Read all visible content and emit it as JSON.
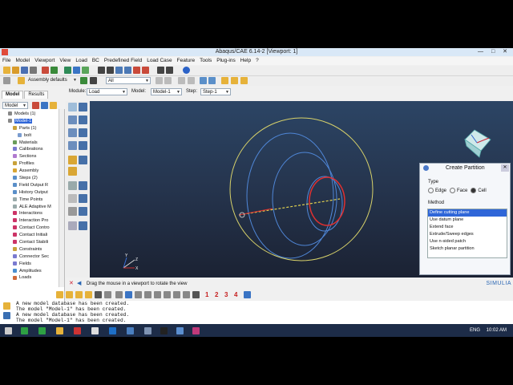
{
  "window": {
    "title": "Abaqus/CAE 6.14-2 [Viewport: 1]",
    "controls": "— □ ✕"
  },
  "menu": [
    "File",
    "Model",
    "Viewport",
    "View",
    "Load",
    "BC",
    "Predefined Field",
    "Load Case",
    "Feature",
    "Tools",
    "Plug-ins",
    "Help",
    "?"
  ],
  "toolbar2": {
    "assembly_defaults": "Assembly defaults",
    "all": "All"
  },
  "context": {
    "module_label": "Module:",
    "module_value": "Load",
    "model_label": "Model:",
    "model_value": "Model-1",
    "step_label": "Step:",
    "step_value": "Step-1"
  },
  "tree_tabs": [
    "Model",
    "Results"
  ],
  "tree_selector": "Model",
  "tree_items": [
    {
      "label": "Models (1)",
      "selected": false
    },
    {
      "label": "Model-1",
      "selected": true
    },
    {
      "label": "Parts (1)",
      "selected": false
    },
    {
      "label": "bolt",
      "selected": false
    },
    {
      "label": "Materials",
      "selected": false
    },
    {
      "label": "Calibrations",
      "selected": false
    },
    {
      "label": "Sections",
      "selected": false
    },
    {
      "label": "Profiles",
      "selected": false
    },
    {
      "label": "Assembly",
      "selected": false
    },
    {
      "label": "Steps (2)",
      "selected": false
    },
    {
      "label": "Field Output R",
      "selected": false
    },
    {
      "label": "History Output",
      "selected": false
    },
    {
      "label": "Time Points",
      "selected": false
    },
    {
      "label": "ALE Adaptive M",
      "selected": false
    },
    {
      "label": "Interactions",
      "selected": false
    },
    {
      "label": "Interaction Pro",
      "selected": false
    },
    {
      "label": "Contact Contro",
      "selected": false
    },
    {
      "label": "Contact Initiali",
      "selected": false
    },
    {
      "label": "Contact Stabili",
      "selected": false
    },
    {
      "label": "Constraints",
      "selected": false
    },
    {
      "label": "Connector Sec",
      "selected": false
    },
    {
      "label": "Fields",
      "selected": false
    },
    {
      "label": "Amplitudes",
      "selected": false
    },
    {
      "label": "Loads",
      "selected": false
    },
    {
      "label": "BCs",
      "selected": false
    }
  ],
  "prompt": {
    "text": "Drag the mouse in a viewport to rotate the view",
    "brand": "SIMULIA"
  },
  "msg_toolbar_numbers": [
    "1",
    "2",
    "3",
    "4"
  ],
  "messages": [
    "A new model database has been created.",
    "The model \"Model-1\" has been created.",
    "A new model database has been created.",
    "The model \"Model-1\" has been created."
  ],
  "dialog": {
    "title": "Create Partition",
    "type_label": "Type",
    "types": [
      {
        "label": "Edge",
        "selected": false
      },
      {
        "label": "Face",
        "selected": false
      },
      {
        "label": "Cell",
        "selected": true
      }
    ],
    "method_label": "Method",
    "methods": [
      {
        "label": "Define cutting plane",
        "selected": true
      },
      {
        "label": "Use datum plane",
        "selected": false
      },
      {
        "label": "Extend face",
        "selected": false
      },
      {
        "label": "Extrude/Sweep edges",
        "selected": false
      },
      {
        "label": "Use n-sided patch",
        "selected": false
      },
      {
        "label": "Sketch planar partition",
        "selected": false
      }
    ]
  },
  "viewport_labels": {
    "axis_x": "X",
    "axis_y": "Y",
    "axis_z": "Z"
  },
  "taskbar": {
    "lang": "ENG",
    "time": "10:02 AM"
  }
}
